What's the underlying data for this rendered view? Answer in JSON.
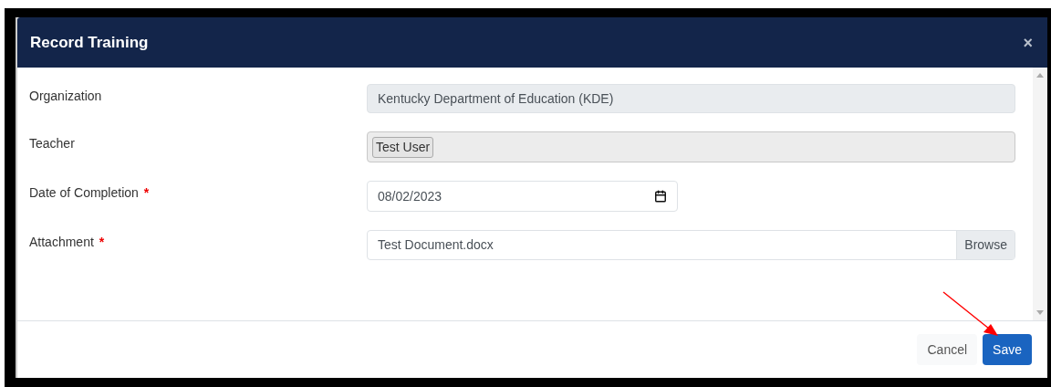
{
  "dialog": {
    "title": "Record Training",
    "close": "×",
    "fields": [
      {
        "kind": "readonly",
        "label": "Organization",
        "value": "Kentucky Department of Education (KDE)"
      },
      {
        "kind": "tags",
        "label": "Teacher",
        "tags": [
          "Test User"
        ]
      },
      {
        "kind": "date",
        "label": "Date of Completion",
        "required_mark": "*",
        "value": "08/02/2023"
      },
      {
        "kind": "file",
        "label": "Attachment",
        "required_mark": "*",
        "value": "Test Document.docx",
        "button": "Browse"
      }
    ],
    "buttons": [
      {
        "kind": "secondary",
        "label": "Cancel"
      },
      {
        "kind": "primary",
        "label": "Save"
      }
    ]
  }
}
